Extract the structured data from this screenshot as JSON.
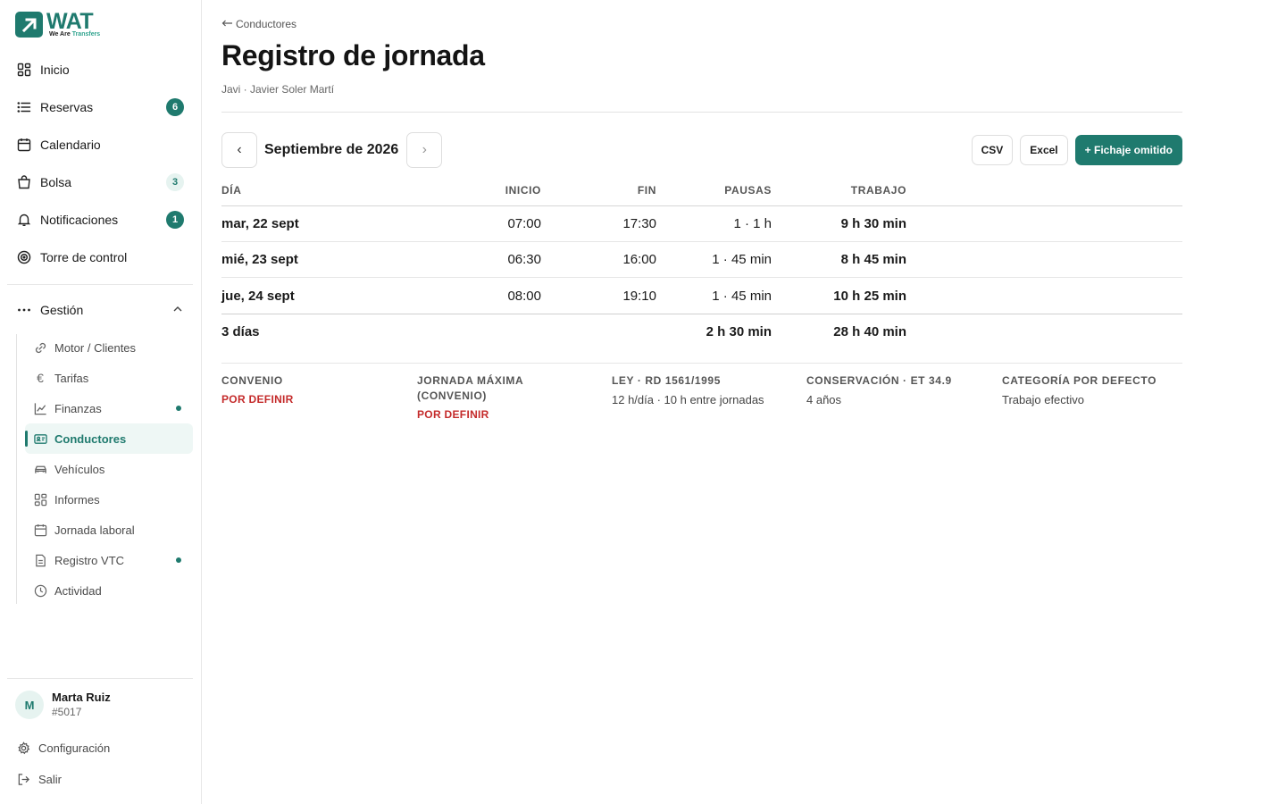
{
  "brand": {
    "name": "WAT",
    "tagline_a": "We Are",
    "tagline_b": "Transfers"
  },
  "nav": [
    {
      "label": "Inicio",
      "icon": "grid-icon"
    },
    {
      "label": "Reservas",
      "icon": "list-icon",
      "badge": "6"
    },
    {
      "label": "Calendario",
      "icon": "calendar-icon"
    },
    {
      "label": "Bolsa",
      "icon": "bag-icon",
      "badge": "3"
    },
    {
      "label": "Notificaciones",
      "icon": "bell-icon",
      "badge": "1"
    },
    {
      "label": "Torre de control",
      "icon": "target-icon"
    }
  ],
  "group": {
    "label": "Gestión"
  },
  "subnav": [
    {
      "label": "Motor / Clientes"
    },
    {
      "label": "Tarifas"
    },
    {
      "label": "Finanzas"
    },
    {
      "label": "Conductores"
    },
    {
      "label": "Vehículos"
    },
    {
      "label": "Informes"
    },
    {
      "label": "Jornada laboral"
    },
    {
      "label": "Registro VTC"
    },
    {
      "label": "Actividad"
    }
  ],
  "user": {
    "initial": "M",
    "name": "Marta Ruiz",
    "id": "#5017"
  },
  "footer": {
    "settings": "Configuración",
    "logout": "Salir"
  },
  "page": {
    "back": "Conductores",
    "title": "Registro de jornada",
    "subtitle": "Javi · Javier Soler Martí",
    "month": "Septiembre de 2026",
    "prev": "‹",
    "next": "›"
  },
  "actions": {
    "csv": "CSV",
    "excel": "Excel",
    "add": "+ Fichaje omitido"
  },
  "table": {
    "headers": {
      "day": "DÍA",
      "start": "INICIO",
      "end": "FIN",
      "breaks": "PAUSAS",
      "work": "TRABAJO"
    },
    "rows": [
      {
        "day": "mar, 22 sept",
        "start": "07:00",
        "end": "17:30",
        "breaks": "1 · 1 h",
        "work": "9 h 30 min"
      },
      {
        "day": "mié, 23 sept",
        "start": "06:30",
        "end": "16:00",
        "breaks": "1 · 45 min",
        "work": "8 h 45 min"
      },
      {
        "day": "jue, 24 sept",
        "start": "08:00",
        "end": "19:10",
        "breaks": "1 · 45 min",
        "work": "10 h 25 min"
      }
    ],
    "total": {
      "day": "3 días",
      "breaks": "2 h 30 min",
      "work": "28 h 40 min"
    }
  },
  "info": [
    {
      "title": "CONVENIO",
      "value": "POR DEFINIR",
      "warn": true
    },
    {
      "title": "JORNADA MÁXIMA (CONVENIO)",
      "value": "POR DEFINIR",
      "warn": true
    },
    {
      "title": "LEY · RD 1561/1995",
      "value": "12 h/día · 10 h entre jornadas",
      "warn": false
    },
    {
      "title": "CONSERVACIÓN · ET 34.9",
      "value": "4 años",
      "warn": false
    },
    {
      "title": "CATEGORÍA POR DEFECTO",
      "value": "Trabajo efectivo",
      "warn": false
    }
  ],
  "colors": {
    "accent": "#1f7a6e",
    "warn": "#c42b2b"
  }
}
